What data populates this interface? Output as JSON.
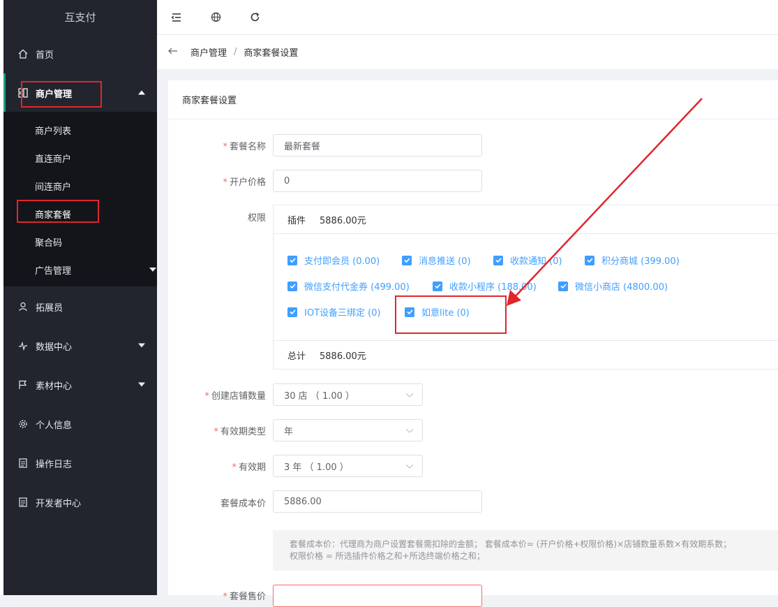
{
  "app": {
    "brand": "互支付"
  },
  "sidebar": {
    "items": [
      {
        "label": "首页",
        "icon": "home-icon"
      },
      {
        "label": "商户管理",
        "icon": "merchant-icon"
      },
      {
        "label": "拓展员",
        "icon": "user-icon"
      },
      {
        "label": "数据中心",
        "icon": "pulse-icon"
      },
      {
        "label": "素材中心",
        "icon": "flag-icon"
      },
      {
        "label": "个人信息",
        "icon": "gear-icon"
      },
      {
        "label": "操作日志",
        "icon": "log-icon"
      },
      {
        "label": "开发者中心",
        "icon": "developer-icon"
      }
    ],
    "sub": [
      "商户列表",
      "直连商户",
      "间连商户",
      "商家套餐",
      "聚合码",
      "广告管理"
    ]
  },
  "breadcrumb": {
    "parent": "商户管理",
    "sep": "/",
    "current": "商家套餐设置"
  },
  "card": {
    "title": "商家套餐设置"
  },
  "form": {
    "name_label": "套餐名称",
    "name_value": "最新套餐",
    "price_label": "开户价格",
    "price_value": "0",
    "perm_label": "权限",
    "plugin_head": "插件",
    "plugin_total": "5886.00元",
    "plugins": [
      "支付即会员 (0.00)",
      "消息推送 (0)",
      "收款通知 (0)",
      "积分商城 (399.00)",
      "微信支付代金券 (499.00)",
      "收款小程序 (188.00)",
      "微信小商店 (4800.00)",
      "IOT设备三绑定 (0)",
      "如意lite (0)"
    ],
    "sum_label": "总计",
    "sum_value": "5886.00元",
    "stores_label": "创建店铺数量",
    "stores_value": "30 店 （ 1.00 ）",
    "period_type_label": "有效期类型",
    "period_type_value": "年",
    "period_label": "有效期",
    "period_value": "3 年 （ 1.00 ）",
    "cost_label": "套餐成本价",
    "cost_value": "5886.00",
    "tip_line1": "套餐成本价：代理商为商户设置套餐需扣除的金额； 套餐成本价= (开户价格+权限价格)×店铺数量系数×有效期系数；",
    "tip_line2": "权限价格 = 所选插件价格之和+所选终端价格之和；",
    "sale_label": "套餐售价",
    "required_mark": "*"
  },
  "colors": {
    "accent": "#409eff",
    "sidebar": "#22252d",
    "annotation": "#e0262c"
  }
}
